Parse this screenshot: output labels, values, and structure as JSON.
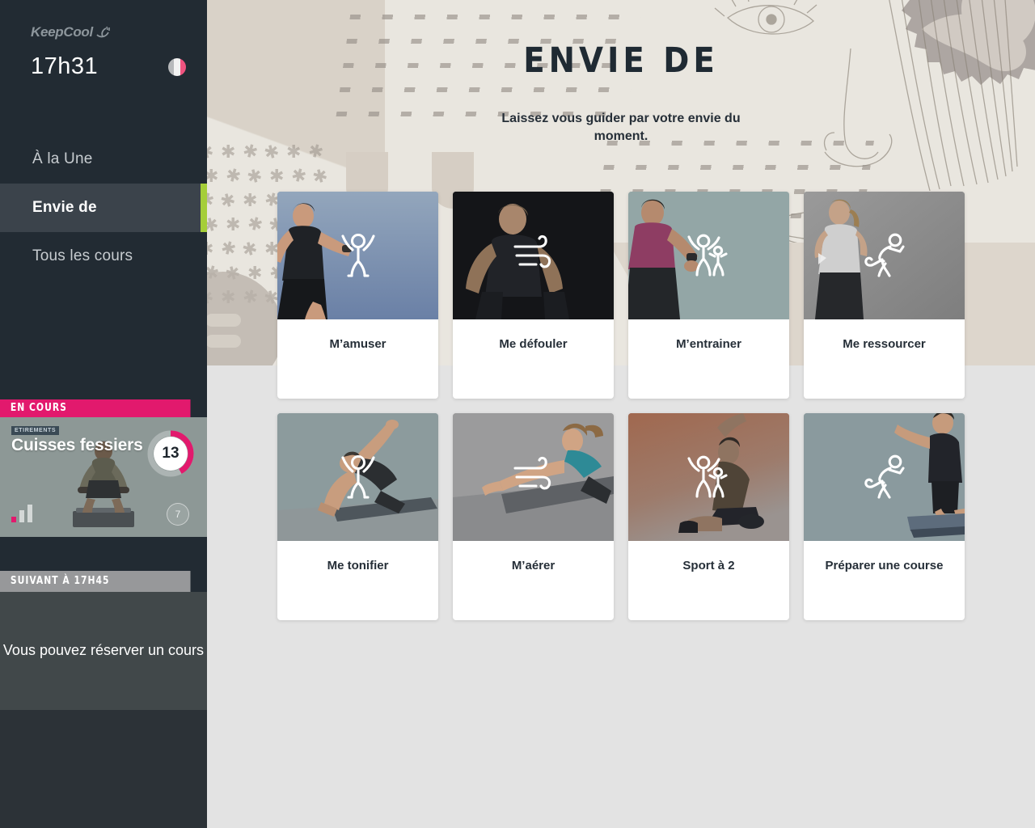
{
  "sidebar": {
    "brand": "KeepCool",
    "brand_icon": "leaf-swoosh-icon",
    "clock": "17h31",
    "flag_icon": "france-flag-icon",
    "nav": [
      {
        "label": "À la Une",
        "active": false
      },
      {
        "label": "Envie de",
        "active": true
      },
      {
        "label": "Tous les cours",
        "active": false
      }
    ],
    "live": {
      "header": "EN COURS",
      "tag": "ETIREMENTS",
      "title": "Cuisses fessiers",
      "countdown": "13",
      "progress_pct": 42,
      "intensity_icon": "signal-bars-icon",
      "intensity_level": 1,
      "participants": "7"
    },
    "next": {
      "header": "SUIVANT À 17H45",
      "message": "Vous pouvez réserver un cours"
    }
  },
  "main": {
    "title": "ENVIE DE",
    "subtitle": "Laissez vous guider par votre envie du moment.",
    "cards": [
      {
        "label": "M’amuser",
        "icon": "jumping-person-icon",
        "tint": "#7e93ae"
      },
      {
        "label": "Me défouler",
        "icon": "wind-icon",
        "tint": "#15171a"
      },
      {
        "label": "M’entrainer",
        "icon": "two-people-icon",
        "tint": "#93a5a6"
      },
      {
        "label": "Me ressourcer",
        "icon": "running-person-icon",
        "tint": "#8d8d8d"
      },
      {
        "label": "Me tonifier",
        "icon": "jumping-person-icon",
        "tint": "#8b9a9c"
      },
      {
        "label": "M’aérer",
        "icon": "wind-icon",
        "tint": "#9b9b9c"
      },
      {
        "label": "Sport à 2",
        "icon": "two-people-icon",
        "tint": "#a0684f"
      },
      {
        "label": "Préparer une course",
        "icon": "running-person-icon",
        "tint": "#8a9a9e"
      }
    ]
  },
  "colors": {
    "sidebar_bg": "#222b33",
    "accent_green": "#a5ce39",
    "accent_pink": "#e2196d",
    "page_bg": "#e3e3e3",
    "hero_bg": "#e9e6df",
    "text_dark": "#262f38"
  }
}
